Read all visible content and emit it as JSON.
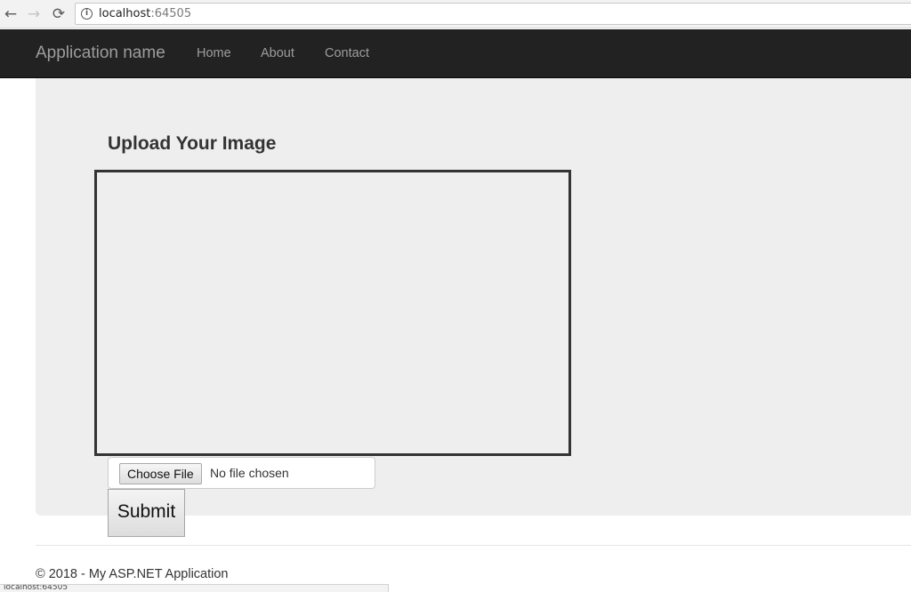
{
  "browser": {
    "back_icon": "←",
    "forward_icon": "→",
    "reload_icon": "⟳",
    "info_icon": "i",
    "url_host": "localhost",
    "url_port": ":64505"
  },
  "navbar": {
    "brand": "Application name",
    "links": [
      "Home",
      "About",
      "Contact"
    ]
  },
  "main": {
    "title": "Upload Your Image",
    "file_input": {
      "button_label": "Choose File",
      "status": "No file chosen"
    },
    "submit_label": "Submit"
  },
  "footer": {
    "text": "© 2018 - My ASP.NET Application"
  },
  "status_bar": {
    "text": "localhost:64505"
  },
  "colors": {
    "navbar_bg": "#222222",
    "navbar_text": "#9d9d9d",
    "jumbotron_bg": "#eeeeee"
  }
}
